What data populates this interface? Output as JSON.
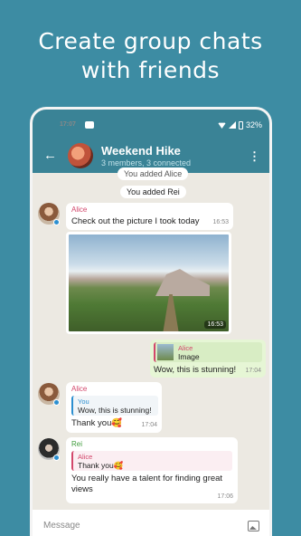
{
  "promo": {
    "line1": "Create group chats",
    "line2": "with friends"
  },
  "status": {
    "time": "17:07",
    "battery": "32%"
  },
  "header": {
    "title": "Weekend Hike",
    "subtitle": "3 members, 3 connected",
    "back_icon": "arrow-back-icon",
    "menu_icon": "more-vert-icon"
  },
  "system_messages": [
    "You added Alice",
    "You added Rei"
  ],
  "messages": [
    {
      "sender": "Alice",
      "text": "Check out the picture I took today",
      "time": "16:53"
    },
    {
      "image_time": "16:53"
    },
    {
      "reply_name": "Alice",
      "reply_text": "Image",
      "text": "Wow, this is stunning!",
      "time": "17:04"
    },
    {
      "sender": "Alice",
      "reply_name": "You",
      "reply_text": "Wow, this is stunning!",
      "text": "Thank you🥰",
      "time": "17:04"
    },
    {
      "sender": "Rei",
      "reply_name": "Alice",
      "reply_text": "Thank you🥰",
      "text": "You really have a talent for finding great views",
      "time": "17:06"
    }
  ],
  "input": {
    "placeholder": "Message",
    "attach_icon": "image-icon"
  },
  "colors": {
    "accent": "#3a8396",
    "background": "#3d8ca3",
    "outgoing": "#e6f6d5",
    "alice": "#d3476b",
    "rei": "#3f9c3c"
  }
}
